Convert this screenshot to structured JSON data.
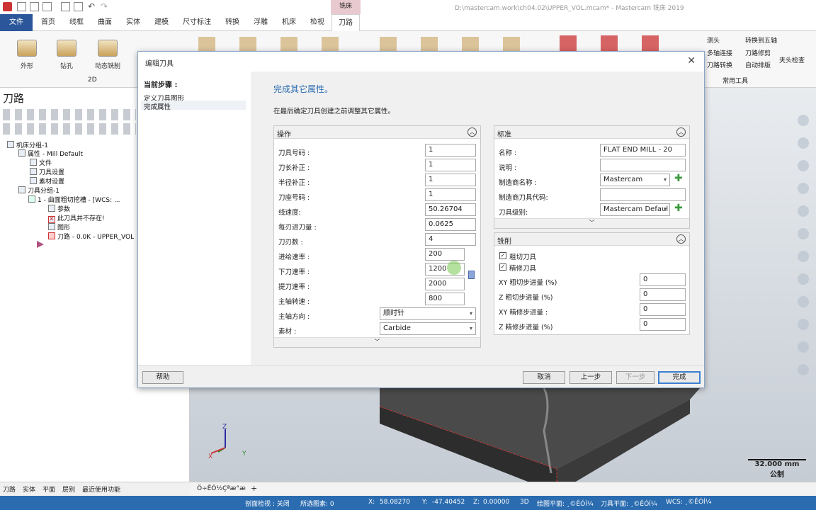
{
  "window": {
    "title_path": "D:\\mastercam.work\\ch04.02\\UPPER_VOL.mcam* - Mastercam 铣床 2019",
    "context_tab": "铣床"
  },
  "tabs": [
    "文件",
    "首页",
    "线框",
    "曲面",
    "实体",
    "建模",
    "尺寸标注",
    "转换",
    "浮雕",
    "机床",
    "检视",
    "刀路"
  ],
  "ribbon": {
    "buttons": [
      "外形",
      "钻孔",
      "动态铣削"
    ],
    "group_2d": "2D",
    "right_tools": [
      "测头",
      "转换到五轴",
      "多轴连接",
      "刀路修剪",
      "刀路转换",
      "自动排版",
      "夹头检查"
    ],
    "common_group": "常用工具"
  },
  "left_panel": {
    "title": "刀路",
    "tree": [
      "机床分组-1",
      "属性 - Mill Default",
      "文件",
      "刀具设置",
      "素材设置",
      "刀具分组-1",
      "1 - 曲面粗切挖槽 - [WCS: ...",
      "参数",
      "此刀具并不存在!",
      "图形",
      "刀路 - 0.0K - UPPER_VOL"
    ],
    "bottom_tabs": [
      "刀路",
      "实体",
      "平面",
      "层别",
      "最近使用功能"
    ]
  },
  "doc_tab": "Ö÷ÊÓ½Çªæ°æ",
  "dialog": {
    "title": "编辑刀具",
    "steps_label": "当前步骤 :",
    "steps": [
      "定义刀具图形",
      "完成属性"
    ],
    "heading": "完成其它属性。",
    "description": "在最后确定刀具创建之前调整其它属性。",
    "ops": {
      "title": "操作",
      "fields": [
        {
          "label": "刀具号码 :",
          "value": "1"
        },
        {
          "label": "刀长补正 :",
          "value": "1"
        },
        {
          "label": "半径补正 :",
          "value": "1"
        },
        {
          "label": "刀座号码 :",
          "value": "1"
        },
        {
          "label": "线速度:",
          "value": "50.26704"
        },
        {
          "label": "每刃进刀量 :",
          "value": "0.0625"
        },
        {
          "label": "刀刃数 :",
          "value": "4"
        },
        {
          "label": "进给速率 :",
          "value": "200"
        },
        {
          "label": "下刀速率 :",
          "value": "1200"
        },
        {
          "label": "提刀速率 :",
          "value": "2000"
        },
        {
          "label": "主轴转速 :",
          "value": "800"
        },
        {
          "label": "主轴方向 :",
          "value": "顺时针"
        },
        {
          "label": "素材 :",
          "value": "Carbide"
        }
      ]
    },
    "std": {
      "title": "标准",
      "fields": [
        {
          "label": "名称 :",
          "value": "FLAT END MILL - 20"
        },
        {
          "label": "说明 :",
          "value": ""
        },
        {
          "label": "制造商名称 :",
          "value": "Mastercam"
        },
        {
          "label": "制造商刀具代码:",
          "value": ""
        },
        {
          "label": "刀具级别:",
          "value": "Mastercam Defaul"
        }
      ]
    },
    "mill": {
      "title": "铣削",
      "checks": [
        {
          "label": "粗切刀具",
          "checked": true
        },
        {
          "label": "精修刀具",
          "checked": true
        }
      ],
      "fields": [
        {
          "label": "XY 粗切步进量 (%)",
          "value": "0"
        },
        {
          "label": "Z 粗切步进量 (%)",
          "value": "0"
        },
        {
          "label": "XY 精修步进量 :",
          "value": "0"
        },
        {
          "label": "Z 精修步进量 (%)",
          "value": "0"
        }
      ]
    },
    "buttons": {
      "help": "帮助",
      "cancel": "取消",
      "prev": "上一步",
      "next": "下一步",
      "finish": "完成"
    }
  },
  "scale": {
    "value": "32.000 mm",
    "unit": "公制"
  },
  "status": {
    "section": "剖面检视 : 关闭",
    "selected": "所选图素: 0",
    "x_label": "X:",
    "x": "58.08270",
    "y_label": "Y:",
    "y": "-47.40452",
    "z_label": "Z:",
    "z": "0.00000",
    "mode": "3D",
    "draw_plane": "绘图平面: ¸©ÊÓÍ¼",
    "tool_plane": "刀具平面: ¸©ÊÓÍ¼",
    "wcs": "WCS: ¸©ÊÓÍ¼"
  },
  "colors": {
    "accent": "#2b579a",
    "status": "#2b6cb0",
    "highlight": "#3c7fd1"
  }
}
